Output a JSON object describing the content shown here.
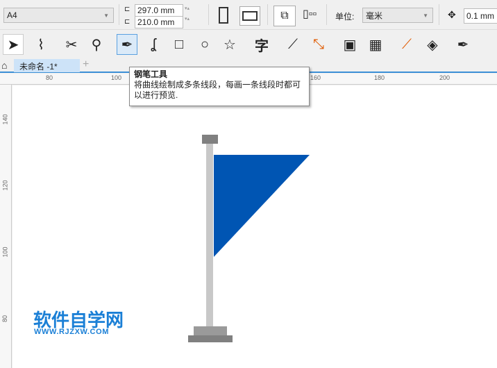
{
  "toolbar": {
    "page_size": "A4",
    "height": "297.0 mm",
    "width": "210.0 mm",
    "unit_label": "单位:",
    "unit_value": "毫米",
    "nudge": "0.1 mm"
  },
  "tools": [
    "pick-tool",
    "shape-tool",
    "crop-tool",
    "zoom-tool",
    "pen-tool",
    "freehand-tool",
    "rectangle-tool",
    "ellipse-tool",
    "polygon-tool",
    "text-tool",
    "dimension-tool",
    "connector-tool",
    "contour-tool",
    "transparency-tool",
    "eyedropper-tool",
    "fill-tool",
    "outline-pen-tool"
  ],
  "tab": {
    "label": "未命名 -1*",
    "add": "+"
  },
  "tooltip": {
    "title": "钢笔工具",
    "body": "将曲线绘制成多条线段，每画一条线段时都可以进行预览."
  },
  "ruler_top": [
    "80",
    "100",
    "160",
    "180",
    "200"
  ],
  "ruler_left": [
    "140",
    "120",
    "100",
    "80"
  ],
  "watermark": {
    "title": "软件自学网",
    "url": "WWW.RJZXW.COM"
  },
  "colors": {
    "flag": "#0055b3",
    "pole": "#c8c8c8",
    "cap": "#808080",
    "accent": "#3b8fd6"
  }
}
